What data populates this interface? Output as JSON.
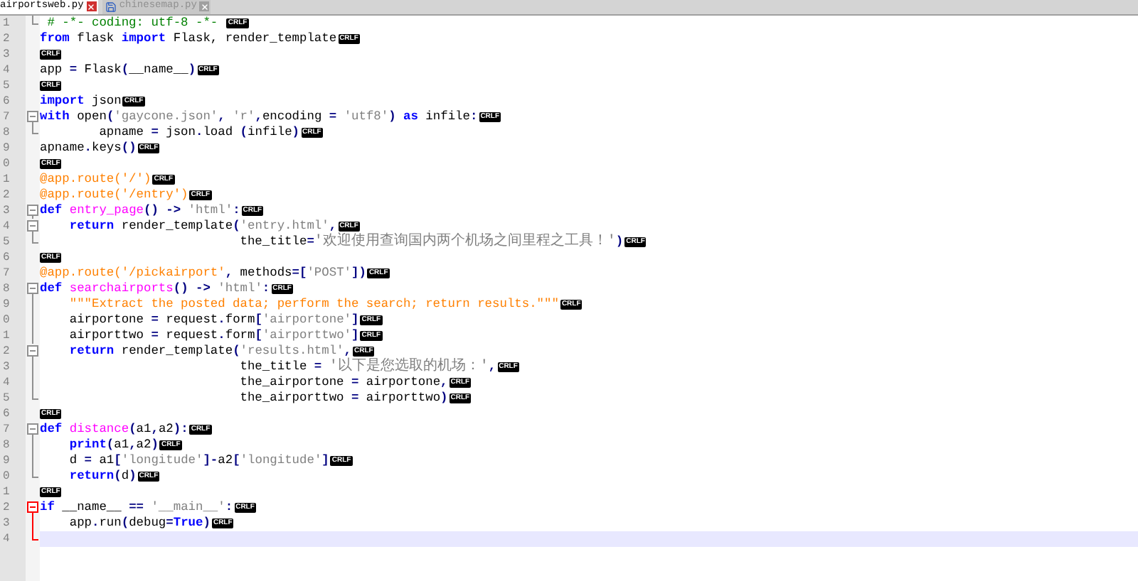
{
  "tabs": [
    {
      "label": "airportsweb.py",
      "selected": true
    },
    {
      "label": "chinesemap.py",
      "selected": false
    }
  ],
  "lines": [
    {
      "number": "1",
      "fold": {
        "kind": "end",
        "active": false
      },
      "current": false,
      "eol": "CRLF",
      "tokens": [
        {
          "kind": "comment",
          "text": " # -*- coding: utf-8 -*- "
        }
      ]
    },
    {
      "number": "2",
      "current": false,
      "eol": "CRLF",
      "tokens": [
        {
          "kind": "keyword",
          "text": "from"
        },
        {
          "kind": "plain",
          "text": " flask "
        },
        {
          "kind": "keyword",
          "text": "import"
        },
        {
          "kind": "plain",
          "text": " Flask, render_template"
        }
      ]
    },
    {
      "number": "3",
      "current": false,
      "eol": "CRLF"
    },
    {
      "number": "4",
      "current": false,
      "eol": "CRLF",
      "tokens": [
        {
          "kind": "plain",
          "text": "app "
        },
        {
          "kind": "operator",
          "text": "= "
        },
        {
          "kind": "plain",
          "text": "Flask"
        },
        {
          "kind": "operator",
          "text": "("
        },
        {
          "kind": "plain",
          "text": "__name__"
        },
        {
          "kind": "operator",
          "text": ")"
        }
      ]
    },
    {
      "number": "5",
      "current": false,
      "eol": "CRLF"
    },
    {
      "number": "6",
      "current": false,
      "eol": "CRLF",
      "tokens": [
        {
          "kind": "keyword",
          "text": "import"
        },
        {
          "kind": "plain",
          "text": " json"
        }
      ]
    },
    {
      "number": "7",
      "fold": {
        "kind": "start",
        "active": false
      },
      "current": false,
      "eol": "CRLF",
      "tokens": [
        {
          "kind": "keyword",
          "text": "with"
        },
        {
          "kind": "plain",
          "text": " open"
        },
        {
          "kind": "operator",
          "text": "("
        },
        {
          "kind": "string",
          "text": "'gaycone.json'"
        },
        {
          "kind": "operator",
          "text": ", "
        },
        {
          "kind": "string",
          "text": "'r'"
        },
        {
          "kind": "operator",
          "text": ","
        },
        {
          "kind": "plain",
          "text": "encoding "
        },
        {
          "kind": "operator",
          "text": "= "
        },
        {
          "kind": "string",
          "text": "'utf8'"
        },
        {
          "kind": "operator",
          "text": ") "
        },
        {
          "kind": "keyword",
          "text": "as"
        },
        {
          "kind": "plain",
          "text": " infile"
        },
        {
          "kind": "operator",
          "text": ":"
        }
      ]
    },
    {
      "number": "8",
      "fold": {
        "kind": "end",
        "active": false
      },
      "current": false,
      "eol": "CRLF",
      "tokens": [
        {
          "kind": "plain",
          "text": "        apname "
        },
        {
          "kind": "operator",
          "text": "="
        },
        {
          "kind": "plain",
          "text": " json"
        },
        {
          "kind": "operator",
          "text": "."
        },
        {
          "kind": "plain",
          "text": "load "
        },
        {
          "kind": "operator",
          "text": "("
        },
        {
          "kind": "plain",
          "text": "infile"
        },
        {
          "kind": "operator",
          "text": ")"
        }
      ]
    },
    {
      "number": "9",
      "current": false,
      "eol": "CRLF",
      "tokens": [
        {
          "kind": "plain",
          "text": "apname"
        },
        {
          "kind": "operator",
          "text": "."
        },
        {
          "kind": "plain",
          "text": "keys"
        },
        {
          "kind": "operator",
          "text": "()"
        }
      ]
    },
    {
      "number": "0",
      "current": false,
      "eol": "CRLF"
    },
    {
      "number": "1",
      "current": false,
      "eol": "CRLF",
      "tokens": [
        {
          "kind": "decorator",
          "text": "@app.route('/')"
        }
      ]
    },
    {
      "number": "2",
      "current": false,
      "eol": "CRLF",
      "tokens": [
        {
          "kind": "decorator",
          "text": "@app.route('/entry')"
        }
      ]
    },
    {
      "number": "3",
      "fold": {
        "kind": "start",
        "active": false
      },
      "current": false,
      "eol": "CRLF",
      "tokens": [
        {
          "kind": "keyword",
          "text": "def "
        },
        {
          "kind": "function",
          "text": "entry_page"
        },
        {
          "kind": "operator",
          "text": "() -> "
        },
        {
          "kind": "string",
          "text": "'html'"
        },
        {
          "kind": "operator",
          "text": ":"
        }
      ]
    },
    {
      "number": "4",
      "fold": {
        "kind": "start",
        "active": false
      },
      "current": false,
      "eol": "CRLF",
      "tokens": [
        {
          "kind": "keyword",
          "text": "    return"
        },
        {
          "kind": "plain",
          "text": " render_template"
        },
        {
          "kind": "operator",
          "text": "("
        },
        {
          "kind": "string",
          "text": "'entry.html'"
        },
        {
          "kind": "operator",
          "text": ","
        }
      ]
    },
    {
      "number": "5",
      "fold": {
        "kind": "end",
        "active": false
      },
      "current": false,
      "eol": "CRLF",
      "tokens": [
        {
          "kind": "plain",
          "text": "                           the_title"
        },
        {
          "kind": "operator",
          "text": "="
        },
        {
          "kind": "cjk_string",
          "text": "'欢迎使用查询国内两个机场之间里程之工具！'"
        },
        {
          "kind": "operator",
          "text": ")"
        }
      ]
    },
    {
      "number": "6",
      "current": false,
      "eol": "CRLF"
    },
    {
      "number": "7",
      "current": false,
      "eol": "CRLF",
      "tokens": [
        {
          "kind": "decorator",
          "text": "@app.route('/pickairport'"
        },
        {
          "kind": "operator",
          "text": ","
        },
        {
          "kind": "plain",
          "text": " methods"
        },
        {
          "kind": "operator",
          "text": "=["
        },
        {
          "kind": "string",
          "text": "'POST'"
        },
        {
          "kind": "operator",
          "text": "])"
        }
      ]
    },
    {
      "number": "8",
      "fold": {
        "kind": "start",
        "active": false
      },
      "current": false,
      "eol": "CRLF",
      "tokens": [
        {
          "kind": "keyword",
          "text": "def "
        },
        {
          "kind": "function",
          "text": "searchairports"
        },
        {
          "kind": "operator",
          "text": "() -> "
        },
        {
          "kind": "string",
          "text": "'html'"
        },
        {
          "kind": "operator",
          "text": ":"
        }
      ]
    },
    {
      "number": "9",
      "fold": {
        "kind": "middle",
        "active": false
      },
      "current": false,
      "eol": "CRLF",
      "tokens": [
        {
          "kind": "docstring",
          "text": "    \"\"\"Extract the posted data; perform the search; return results.\"\"\""
        }
      ]
    },
    {
      "number": "0",
      "fold": {
        "kind": "middle",
        "active": false
      },
      "current": false,
      "eol": "CRLF",
      "tokens": [
        {
          "kind": "plain",
          "text": "    airportone "
        },
        {
          "kind": "operator",
          "text": "="
        },
        {
          "kind": "plain",
          "text": " request"
        },
        {
          "kind": "operator",
          "text": "."
        },
        {
          "kind": "plain",
          "text": "form"
        },
        {
          "kind": "operator",
          "text": "["
        },
        {
          "kind": "string",
          "text": "'airportone'"
        },
        {
          "kind": "operator",
          "text": "]"
        }
      ]
    },
    {
      "number": "1",
      "fold": {
        "kind": "middle",
        "active": false
      },
      "current": false,
      "eol": "CRLF",
      "tokens": [
        {
          "kind": "plain",
          "text": "    airporttwo "
        },
        {
          "kind": "operator",
          "text": "="
        },
        {
          "kind": "plain",
          "text": " request"
        },
        {
          "kind": "operator",
          "text": "."
        },
        {
          "kind": "plain",
          "text": "form"
        },
        {
          "kind": "operator",
          "text": "["
        },
        {
          "kind": "string",
          "text": "'airporttwo'"
        },
        {
          "kind": "operator",
          "text": "]"
        }
      ]
    },
    {
      "number": "2",
      "fold": {
        "kind": "start",
        "active": false
      },
      "current": false,
      "eol": "CRLF",
      "tokens": [
        {
          "kind": "keyword",
          "text": "    return"
        },
        {
          "kind": "plain",
          "text": " render_template"
        },
        {
          "kind": "operator",
          "text": "("
        },
        {
          "kind": "string",
          "text": "'results.html'"
        },
        {
          "kind": "operator",
          "text": ","
        }
      ]
    },
    {
      "number": "3",
      "fold": {
        "kind": "middle",
        "active": false
      },
      "current": false,
      "eol": "CRLF",
      "tokens": [
        {
          "kind": "plain",
          "text": "                           the_title "
        },
        {
          "kind": "operator",
          "text": "= "
        },
        {
          "kind": "cjk_string",
          "text": "'以下是您选取的机场：'"
        },
        {
          "kind": "operator",
          "text": ","
        }
      ]
    },
    {
      "number": "4",
      "fold": {
        "kind": "middle",
        "active": false
      },
      "current": false,
      "eol": "CRLF",
      "tokens": [
        {
          "kind": "plain",
          "text": "                           the_airportone "
        },
        {
          "kind": "operator",
          "text": "="
        },
        {
          "kind": "plain",
          "text": " airportone"
        },
        {
          "kind": "operator",
          "text": ","
        }
      ]
    },
    {
      "number": "5",
      "fold": {
        "kind": "end",
        "active": false
      },
      "current": false,
      "eol": "CRLF",
      "tokens": [
        {
          "kind": "plain",
          "text": "                           the_airporttwo "
        },
        {
          "kind": "operator",
          "text": "="
        },
        {
          "kind": "plain",
          "text": " airporttwo"
        },
        {
          "kind": "operator",
          "text": ")"
        }
      ]
    },
    {
      "number": "6",
      "current": false,
      "eol": "CRLF"
    },
    {
      "number": "7",
      "fold": {
        "kind": "start",
        "active": false
      },
      "current": false,
      "eol": "CRLF",
      "tokens": [
        {
          "kind": "keyword",
          "text": "def "
        },
        {
          "kind": "function",
          "text": "distance"
        },
        {
          "kind": "operator",
          "text": "("
        },
        {
          "kind": "plain",
          "text": "a1"
        },
        {
          "kind": "operator",
          "text": ","
        },
        {
          "kind": "plain",
          "text": "a2"
        },
        {
          "kind": "operator",
          "text": "):"
        }
      ]
    },
    {
      "number": "8",
      "fold": {
        "kind": "middle",
        "active": false
      },
      "current": false,
      "eol": "CRLF",
      "tokens": [
        {
          "kind": "keyword",
          "text": "    print"
        },
        {
          "kind": "operator",
          "text": "("
        },
        {
          "kind": "plain",
          "text": "a1"
        },
        {
          "kind": "operator",
          "text": ","
        },
        {
          "kind": "plain",
          "text": "a2"
        },
        {
          "kind": "operator",
          "text": ")"
        }
      ]
    },
    {
      "number": "9",
      "fold": {
        "kind": "middle",
        "active": false
      },
      "current": false,
      "eol": "CRLF",
      "tokens": [
        {
          "kind": "plain",
          "text": "    d "
        },
        {
          "kind": "operator",
          "text": "="
        },
        {
          "kind": "plain",
          "text": " a1"
        },
        {
          "kind": "operator",
          "text": "["
        },
        {
          "kind": "string",
          "text": "'longitude'"
        },
        {
          "kind": "operator",
          "text": "]-"
        },
        {
          "kind": "plain",
          "text": "a2"
        },
        {
          "kind": "operator",
          "text": "["
        },
        {
          "kind": "string",
          "text": "'longitude'"
        },
        {
          "kind": "operator",
          "text": "]"
        }
      ]
    },
    {
      "number": "0",
      "fold": {
        "kind": "end",
        "active": false
      },
      "current": false,
      "eol": "CRLF",
      "tokens": [
        {
          "kind": "keyword",
          "text": "    return"
        },
        {
          "kind": "operator",
          "text": "("
        },
        {
          "kind": "plain",
          "text": "d"
        },
        {
          "kind": "operator",
          "text": ")"
        }
      ]
    },
    {
      "number": "1",
      "current": false,
      "eol": "CRLF"
    },
    {
      "number": "2",
      "fold": {
        "kind": "start",
        "active": true
      },
      "current": false,
      "eol": "CRLF",
      "tokens": [
        {
          "kind": "keyword",
          "text": "if"
        },
        {
          "kind": "plain",
          "text": " __name__ "
        },
        {
          "kind": "operator",
          "text": "== "
        },
        {
          "kind": "string",
          "text": "'__main__'"
        },
        {
          "kind": "operator",
          "text": ":"
        }
      ]
    },
    {
      "number": "3",
      "fold": {
        "kind": "middle",
        "active": true
      },
      "current": false,
      "eol": "CRLF",
      "tokens": [
        {
          "kind": "plain",
          "text": "    app"
        },
        {
          "kind": "operator",
          "text": "."
        },
        {
          "kind": "plain",
          "text": "run"
        },
        {
          "kind": "operator",
          "text": "("
        },
        {
          "kind": "plain",
          "text": "debug"
        },
        {
          "kind": "operator",
          "text": "="
        },
        {
          "kind": "keyword",
          "text": "True"
        },
        {
          "kind": "operator",
          "text": ")"
        }
      ]
    },
    {
      "number": "4",
      "fold": {
        "kind": "end",
        "active": true
      },
      "current": true
    }
  ]
}
